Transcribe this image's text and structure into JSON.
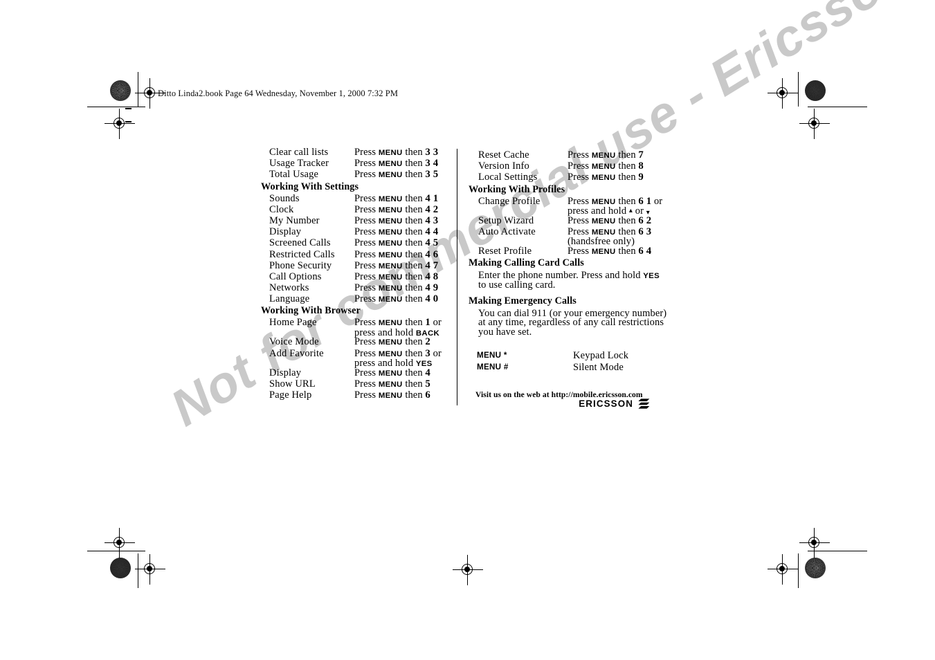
{
  "slug": "Ditto Linda2.book  Page 64  Wednesday, November 1, 2000  7:32 PM",
  "watermark": "Not for commercial use - Ericsson Inc.",
  "colors": {
    "text": "#000000",
    "watermark": "#c9c9c9",
    "rule": "#000000"
  },
  "left_column": {
    "blocks": [
      {
        "type": "items",
        "items": [
          {
            "term": "Clear call lists",
            "action_pre": "Press ",
            "key": "MENU",
            "action_mid": " then ",
            "num": "3 3"
          },
          {
            "term": "Usage Tracker",
            "action_pre": "Press ",
            "key": "MENU",
            "action_mid": " then ",
            "num": "3 4"
          },
          {
            "term": "Total Usage",
            "action_pre": "Press ",
            "key": "MENU",
            "action_mid": " then ",
            "num": "3 5"
          }
        ]
      },
      {
        "type": "heading",
        "text": "Working With Settings"
      },
      {
        "type": "items",
        "items": [
          {
            "term": "Sounds",
            "action_pre": "Press ",
            "key": "MENU",
            "action_mid": " then ",
            "num": "4 1"
          },
          {
            "term": "Clock",
            "action_pre": "Press ",
            "key": "MENU",
            "action_mid": " then ",
            "num": "4 2"
          },
          {
            "term": "My Number",
            "action_pre": "Press ",
            "key": "MENU",
            "action_mid": " then ",
            "num": "4 3"
          },
          {
            "term": "Display",
            "action_pre": "Press ",
            "key": "MENU",
            "action_mid": " then ",
            "num": "4 4"
          },
          {
            "term": "Screened Calls",
            "action_pre": "Press ",
            "key": "MENU",
            "action_mid": " then ",
            "num": "4 5"
          },
          {
            "term": "Restricted Calls",
            "action_pre": "Press ",
            "key": "MENU",
            "action_mid": " then ",
            "num": "4 6"
          },
          {
            "term": "Phone Security",
            "action_pre": "Press ",
            "key": "MENU",
            "action_mid": " then ",
            "num": "4 7"
          },
          {
            "term": "Call Options",
            "action_pre": "Press ",
            "key": "MENU",
            "action_mid": " then ",
            "num": "4 8"
          },
          {
            "term": "Networks",
            "action_pre": "Press ",
            "key": "MENU",
            "action_mid": " then ",
            "num": "4 9"
          },
          {
            "term": "Language",
            "action_pre": "Press ",
            "key": "MENU",
            "action_mid": " then ",
            "num": "4 0"
          }
        ]
      },
      {
        "type": "heading",
        "text": "Working With Browser"
      },
      {
        "type": "items",
        "items": [
          {
            "term": "Home Page",
            "action_pre": "Press ",
            "key": "MENU",
            "action_mid": " then ",
            "num": "1",
            "action_post": " or",
            "line2_pre": "press and hold ",
            "line2_key": "BACK"
          },
          {
            "term": "Voice Mode",
            "action_pre": "Press ",
            "key": "MENU",
            "action_mid": " then ",
            "num": "2"
          },
          {
            "term": "Add Favorite",
            "action_pre": "Press ",
            "key": "MENU",
            "action_mid": " then ",
            "num": "3",
            "action_post": " or",
            "line2_pre": "press and hold ",
            "line2_key": "YES"
          },
          {
            "term": "Display",
            "action_pre": "Press ",
            "key": "MENU",
            "action_mid": " then ",
            "num": "4"
          },
          {
            "term": "Show URL",
            "action_pre": "Press ",
            "key": "MENU",
            "action_mid": " then ",
            "num": "5"
          },
          {
            "term": "Page Help",
            "action_pre": "Press ",
            "key": "MENU",
            "action_mid": " then ",
            "num": "6"
          }
        ]
      }
    ]
  },
  "right_column": {
    "items_top": [
      {
        "term": "Reset Cache",
        "action_pre": "Press ",
        "key": "MENU",
        "action_mid": " then ",
        "num": "7"
      },
      {
        "term": "Version Info",
        "action_pre": "Press ",
        "key": "MENU",
        "action_mid": " then ",
        "num": "8"
      },
      {
        "term": "Local Settings",
        "action_pre": "Press ",
        "key": "MENU",
        "action_mid": " then ",
        "num": "9"
      }
    ],
    "profiles_heading": "Working With Profiles",
    "items_profiles": [
      {
        "term": "Change Profile",
        "action_pre": "Press ",
        "key": "MENU",
        "action_mid": " then ",
        "num": "6 1",
        "action_post": " or",
        "line2_pre": "press and hold ",
        "line2_arrow_up": "▴",
        "line2_mid": " or ",
        "line2_arrow_dn": "▾"
      },
      {
        "term": "Setup Wizard",
        "action_pre": "Press ",
        "key": "MENU",
        "action_mid": " then ",
        "num": "6 2"
      },
      {
        "term": "Auto Activate",
        "action_pre": "Press ",
        "key": "MENU",
        "action_mid": " then ",
        "num": "6 3",
        "line2_plain": "(handsfree only)"
      },
      {
        "term": "Reset Profile",
        "action_pre": "Press ",
        "key": "MENU",
        "action_mid": " then ",
        "num": "6 4"
      }
    ],
    "calling_card_heading": "Making Calling Card Calls",
    "calling_card_lines": [
      {
        "pre": "Enter the phone number. Press and hold ",
        "key": "YES"
      },
      {
        "pre": "to use calling card."
      }
    ],
    "emergency_heading": "Making Emergency Calls",
    "emergency_lines": [
      "You can dial 911 (or your emergency number)",
      "at any time, regardless of any call restrictions",
      "you have set."
    ],
    "shortcut_rows": [
      {
        "keys": "MENU *",
        "value": "Keypad Lock"
      },
      {
        "keys": "MENU #",
        "value": "Silent Mode"
      }
    ]
  },
  "footer": {
    "web_line": "Visit us on the web at http://mobile.ericsson.com",
    "logo_word": "ERICSSON",
    "logo_mark": "ericsson-three-stripe-mark"
  }
}
